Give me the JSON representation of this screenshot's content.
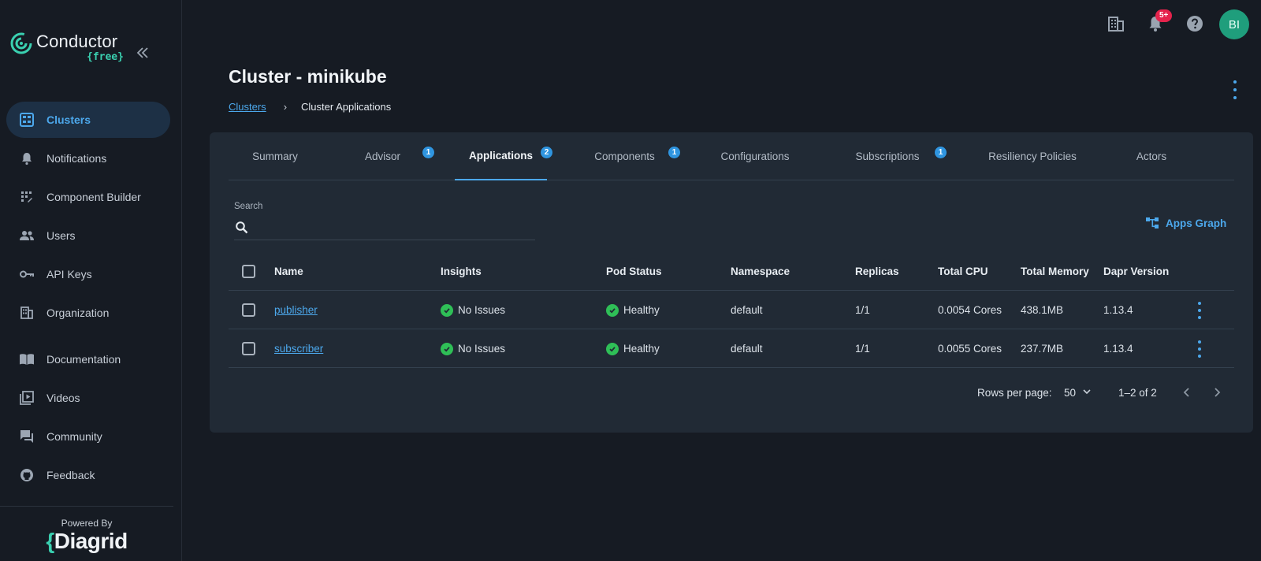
{
  "brand": {
    "name": "Conductor",
    "plan": "{free}",
    "powered_by": "Powered By",
    "footer_brand_curly": "{",
    "footer_brand_rest": "Diagrid"
  },
  "sidebar": {
    "items": [
      {
        "label": "Clusters",
        "icon": "clusters-icon",
        "active": true
      },
      {
        "label": "Notifications",
        "icon": "bell-icon"
      },
      {
        "label": "Component Builder",
        "icon": "builder-icon"
      },
      {
        "label": "Users",
        "icon": "users-icon"
      },
      {
        "label": "API Keys",
        "icon": "key-icon"
      },
      {
        "label": "Organization",
        "icon": "organization-icon"
      },
      {
        "label": "Documentation",
        "icon": "book-icon"
      },
      {
        "label": "Videos",
        "icon": "video-icon"
      },
      {
        "label": "Community",
        "icon": "chat-icon"
      },
      {
        "label": "Feedback",
        "icon": "github-icon"
      }
    ]
  },
  "topbar": {
    "notifications_badge": "5+",
    "avatar_initials": "BI"
  },
  "header": {
    "title": "Cluster - minikube",
    "breadcrumb": {
      "link": "Clusters",
      "separator": "›",
      "current": "Cluster Applications"
    }
  },
  "tabs": [
    {
      "label": "Summary"
    },
    {
      "label": "Advisor",
      "badge": "1"
    },
    {
      "label": "Applications",
      "badge": "2",
      "active": true
    },
    {
      "label": "Components",
      "badge": "1"
    },
    {
      "label": "Configurations"
    },
    {
      "label": "Subscriptions",
      "badge": "1"
    },
    {
      "label": "Resiliency Policies"
    },
    {
      "label": "Actors"
    }
  ],
  "search": {
    "label": "Search",
    "value": "",
    "placeholder": ""
  },
  "apps_graph_label": "Apps Graph",
  "table": {
    "columns": [
      "Name",
      "Insights",
      "Pod Status",
      "Namespace",
      "Replicas",
      "Total CPU",
      "Total Memory",
      "Dapr Version"
    ],
    "rows": [
      {
        "name": "publisher",
        "insights": "No Issues",
        "pod_status": "Healthy",
        "namespace": "default",
        "replicas": "1/1",
        "cpu": "0.0054 Cores",
        "memory": "438.1MB",
        "dapr": "1.13.4"
      },
      {
        "name": "subscriber",
        "insights": "No Issues",
        "pod_status": "Healthy",
        "namespace": "default",
        "replicas": "1/1",
        "cpu": "0.0055 Cores",
        "memory": "237.7MB",
        "dapr": "1.13.4"
      }
    ]
  },
  "pagination": {
    "rows_label": "Rows per page:",
    "rows_value": "50",
    "range": "1–2 of 2"
  },
  "colors": {
    "accent": "#4ca8ec",
    "success": "#2fbf57",
    "badge": "#e5234c",
    "avatar": "#1f9e7c",
    "brand_teal": "#3ad0b0"
  }
}
